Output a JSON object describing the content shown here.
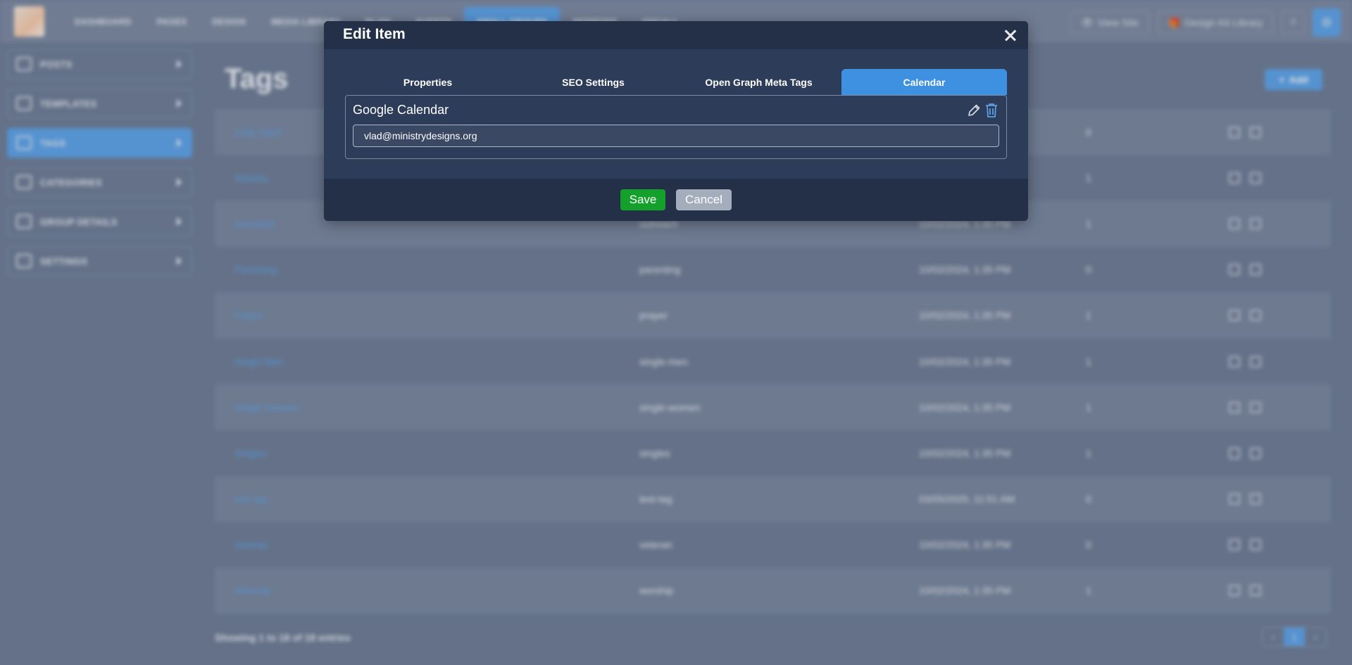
{
  "app": {
    "nav": [
      "DASHBOARD",
      "PAGES",
      "DESIGN",
      "MEDIA LIBRARY",
      "BLOG",
      "EVENTS",
      "SMALL GROUPS",
      "SERMONS",
      "ONCALL"
    ],
    "nav_active_index": 6,
    "view_site": "View Site",
    "design_kit": "Design Kit Library",
    "help": "?"
  },
  "sidebar": {
    "items": [
      {
        "label": "POSTS",
        "active": false
      },
      {
        "label": "TEMPLATES",
        "active": false
      },
      {
        "label": "TAGS",
        "active": true
      },
      {
        "label": "CATEGORIES",
        "active": false
      },
      {
        "label": "GROUP DETAILS",
        "active": false
      },
      {
        "label": "SETTINGS",
        "active": false
      }
    ]
  },
  "page": {
    "title": "Tags",
    "add_label": "Add",
    "rows": [
      {
        "name": "Daily Spirit",
        "slug": "",
        "date": "",
        "count": "0"
      },
      {
        "name": "Ministry",
        "slug": "",
        "date": "",
        "count": "1"
      },
      {
        "name": "Outreach",
        "slug": "outreach",
        "date": "10/02/2024, 1:35 PM",
        "count": "1"
      },
      {
        "name": "Parenting",
        "slug": "parenting",
        "date": "10/02/2024, 1:35 PM",
        "count": "0"
      },
      {
        "name": "Prayer",
        "slug": "prayer",
        "date": "10/02/2024, 1:35 PM",
        "count": "1"
      },
      {
        "name": "Single Men",
        "slug": "single-men",
        "date": "10/02/2024, 1:35 PM",
        "count": "1"
      },
      {
        "name": "Single Women",
        "slug": "single-women",
        "date": "10/02/2024, 1:35 PM",
        "count": "1"
      },
      {
        "name": "Singles",
        "slug": "singles",
        "date": "10/02/2024, 1:35 PM",
        "count": "1"
      },
      {
        "name": "test tag",
        "slug": "test-tag",
        "date": "03/05/2025, 11:51 AM",
        "count": "0"
      },
      {
        "name": "Veteran",
        "slug": "veteran",
        "date": "10/02/2024, 1:35 PM",
        "count": "0"
      },
      {
        "name": "Worship",
        "slug": "worship",
        "date": "10/02/2024, 1:35 PM",
        "count": "1"
      }
    ],
    "footer_info": "Showing 1 to 18 of 18 entries",
    "pager": {
      "prev": "‹",
      "current": "1",
      "next": "›"
    }
  },
  "modal": {
    "title": "Edit Item",
    "tabs": [
      {
        "label": "Properties",
        "active": false
      },
      {
        "label": "SEO Settings",
        "active": false
      },
      {
        "label": "Open Graph Meta Tags",
        "active": false
      },
      {
        "label": "Calendar",
        "active": true
      }
    ],
    "panel_title": "Google Calendar",
    "email_value": "vlad@ministrydesigns.org",
    "save_label": "Save",
    "cancel_label": "Cancel"
  },
  "colors": {
    "accent": "#3e90e0",
    "save": "#13a02b",
    "cancel": "#a3adbb",
    "modal_bg": "#2d3c59",
    "modal_header": "#243048",
    "icon_blue": "#5aa1e6"
  },
  "icons": [
    "close-icon",
    "pencil-icon",
    "trash-icon",
    "eye-icon",
    "gift-icon",
    "gear-icon"
  ]
}
